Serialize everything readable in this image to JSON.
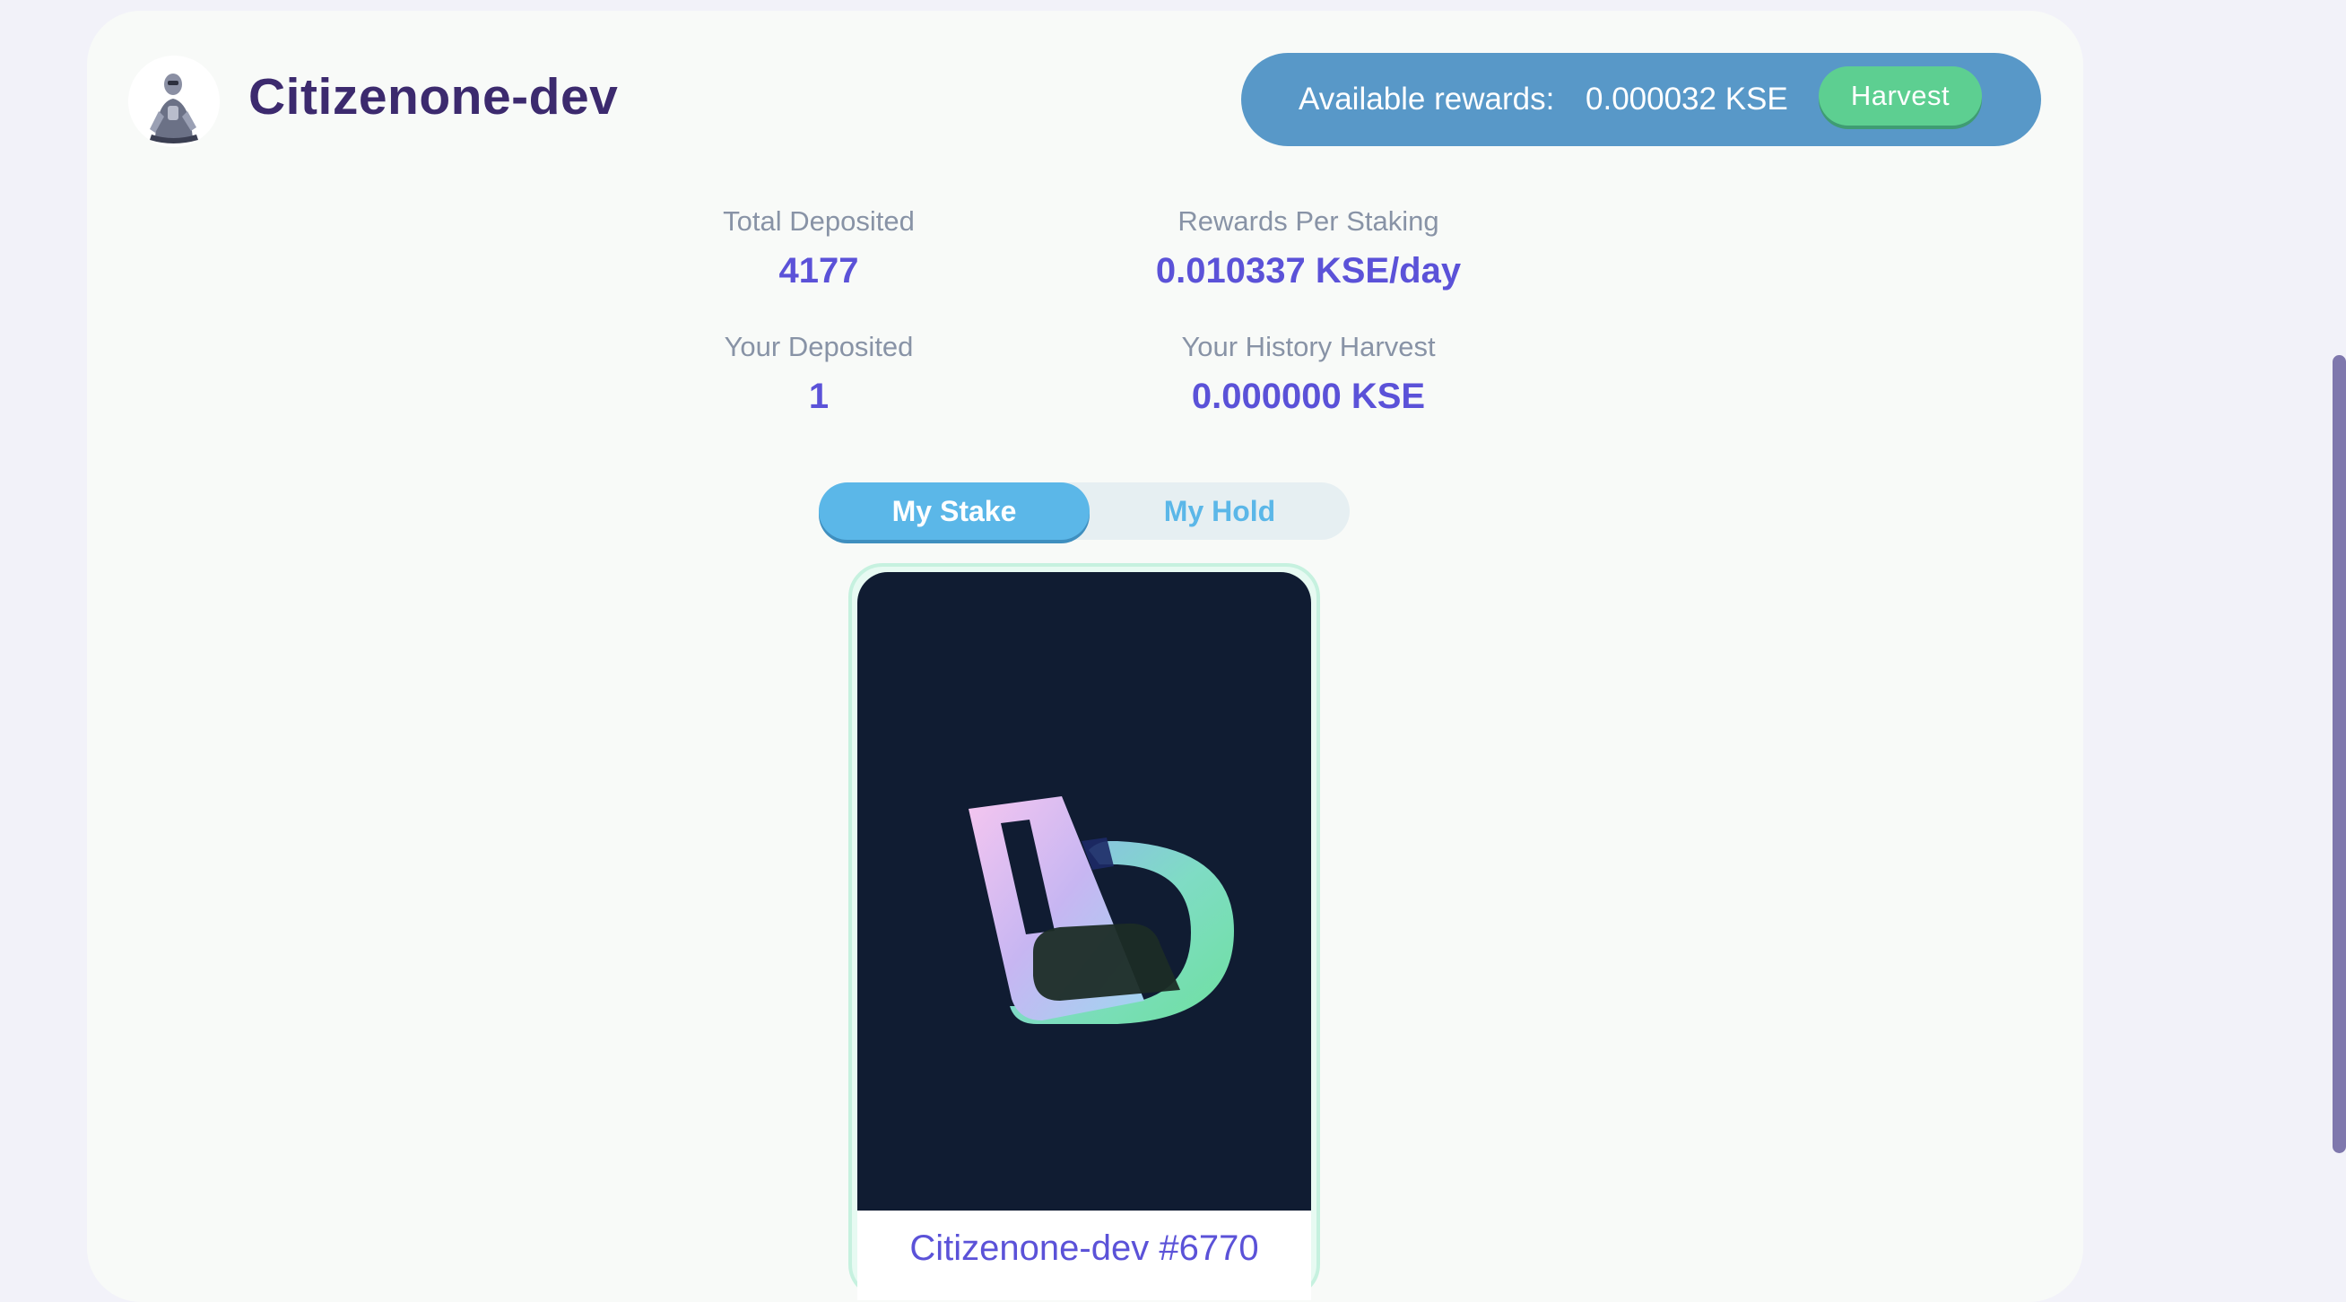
{
  "header": {
    "collection_name": "Citizenone-dev",
    "avatar_icon": "robot-avatar-icon"
  },
  "rewards": {
    "label": "Available rewards:",
    "value": "0.000032 KSE",
    "harvest_label": "Harvest"
  },
  "stats": {
    "total_deposited": {
      "label": "Total Deposited",
      "value": "4177"
    },
    "rewards_per_staking": {
      "label": "Rewards Per Staking",
      "value": "0.010337 KSE/day"
    },
    "your_deposited": {
      "label": "Your Deposited",
      "value": "1"
    },
    "your_history_harvest": {
      "label": "Your History Harvest",
      "value": "0.000000 KSE"
    }
  },
  "tabs": [
    {
      "label": "My Stake",
      "active": true
    },
    {
      "label": "My Hold",
      "active": false
    }
  ],
  "nfts": [
    {
      "name": "Citizenone-dev #6770",
      "image_icon": "citizenone-logo-icon"
    }
  ],
  "colors": {
    "page_background": "#f2f2f9",
    "panel_background": "#f8faf8",
    "title": "#3c2a6e",
    "accent_blue": "#5898c8",
    "tab_blue": "#5bb7e8",
    "harvest_green": "#5dcf91",
    "value_purple": "#5b52d8",
    "label_gray": "#8893a6",
    "nft_background": "#101c32"
  }
}
